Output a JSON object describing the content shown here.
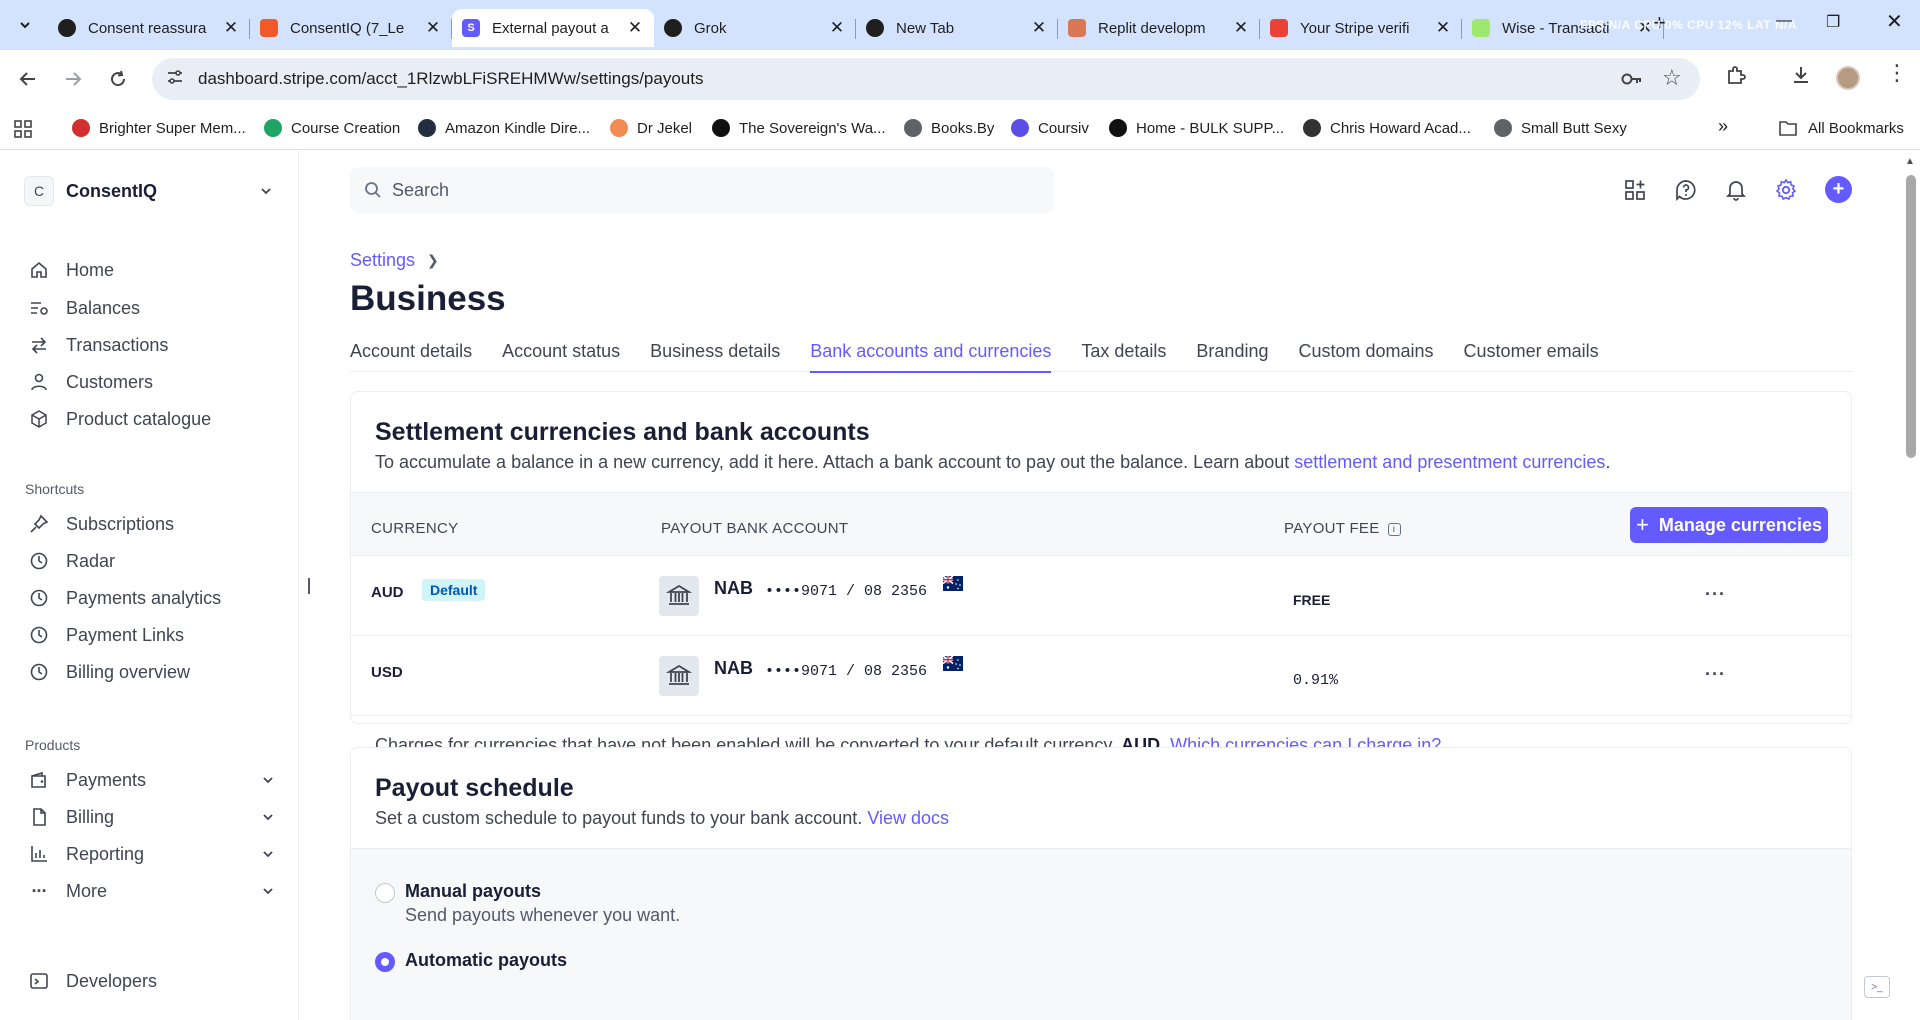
{
  "browser": {
    "tabs": [
      {
        "title": "Consent reassura",
        "favicon": "chatgpt",
        "color": "#1f1f1f"
      },
      {
        "title": "ConsentIQ (7_Le",
        "favicon": "make",
        "color": "#f05a28"
      },
      {
        "title": "External payout a",
        "favicon": "stripe",
        "color": "#635bff",
        "active": true
      },
      {
        "title": "Grok",
        "favicon": "grok",
        "color": "#1f1f1f"
      },
      {
        "title": "New Tab",
        "favicon": "chrome",
        "color": "#1f1f1f"
      },
      {
        "title": "Replit developm",
        "favicon": "claude",
        "color": "#d97757"
      },
      {
        "title": "Your Stripe verifi",
        "favicon": "gmail",
        "color": "#ea4335"
      },
      {
        "title": "Wise - Transacti",
        "favicon": "wise",
        "color": "#9fe870"
      }
    ],
    "sysinfo": "FPS N/A  CPU 0%  CPU 12%  LAT N/A",
    "url": "dashboard.stripe.com/acct_1RlzwbLFiSREHMWw/settings/payouts",
    "bookmarks": [
      {
        "label": "Brighter Super Mem...",
        "color": "#d32f2f"
      },
      {
        "label": "Course Creation",
        "color": "#1fa463"
      },
      {
        "label": "Amazon Kindle Dire...",
        "color": "#232f3e"
      },
      {
        "label": "Dr Jekel",
        "color": "#f28b54"
      },
      {
        "label": "The Sovereign's Wa...",
        "color": "#111111"
      },
      {
        "label": "Books.By",
        "color": "#5f6368"
      },
      {
        "label": "Coursiv",
        "color": "#5b4de6"
      },
      {
        "label": "Home - BULK SUPP...",
        "color": "#111111"
      },
      {
        "label": "Chris Howard Acad...",
        "color": "#333333"
      },
      {
        "label": "Small Butt Sexy",
        "color": "#5f6368"
      }
    ],
    "all_bookmarks": "All Bookmarks"
  },
  "sidebar": {
    "account_initial": "C",
    "account_name": "ConsentIQ",
    "nav": [
      "Home",
      "Balances",
      "Transactions",
      "Customers",
      "Product catalogue"
    ],
    "shortcuts_label": "Shortcuts",
    "shortcuts": [
      "Subscriptions",
      "Radar",
      "Payments analytics",
      "Payment Links",
      "Billing overview"
    ],
    "products_label": "Products",
    "products": [
      "Payments",
      "Billing",
      "Reporting",
      "More"
    ],
    "developers": "Developers"
  },
  "header": {
    "search_placeholder": "Search"
  },
  "page": {
    "breadcrumb": "Settings",
    "title": "Business",
    "tabs": [
      "Account details",
      "Account status",
      "Business details",
      "Bank accounts and currencies",
      "Tax details",
      "Branding",
      "Custom domains",
      "Customer emails"
    ],
    "active_tab": 3
  },
  "settlement": {
    "title": "Settlement currencies and bank accounts",
    "desc_prefix": "To accumulate a balance in a new currency, add it here. Attach a bank account to pay out the balance. Learn about ",
    "desc_link": "settlement and presentment currencies",
    "desc_suffix": ".",
    "col_currency": "CURRENCY",
    "col_bank": "PAYOUT BANK ACCOUNT",
    "col_fee": "PAYOUT FEE",
    "manage_button": "Manage currencies",
    "rows": [
      {
        "currency": "AUD",
        "badge": "Default",
        "bank": "NAB",
        "account": "••••9071 / 08 2356",
        "fee": "FREE"
      },
      {
        "currency": "USD",
        "badge": "",
        "bank": "NAB",
        "account": "••••9071 / 08 2356",
        "fee": "0.91%"
      }
    ],
    "note_prefix": "Charges for currencies that have not been enabled will be converted to your default currency, ",
    "note_bold": "AUD",
    "note_mid": ". ",
    "note_link": "Which currencies can I charge in?"
  },
  "payout": {
    "title": "Payout schedule",
    "desc": "Set a custom schedule to payout funds to your bank account. ",
    "desc_link": "View docs",
    "manual_label": "Manual payouts",
    "manual_desc": "Send payouts whenever you want.",
    "auto_label": "Automatic payouts"
  },
  "colors": {
    "accent": "#635bff",
    "chrome_tabstrip": "#d3e3fd",
    "badge_bg": "#cff5f6",
    "badge_text": "#0055bc"
  }
}
